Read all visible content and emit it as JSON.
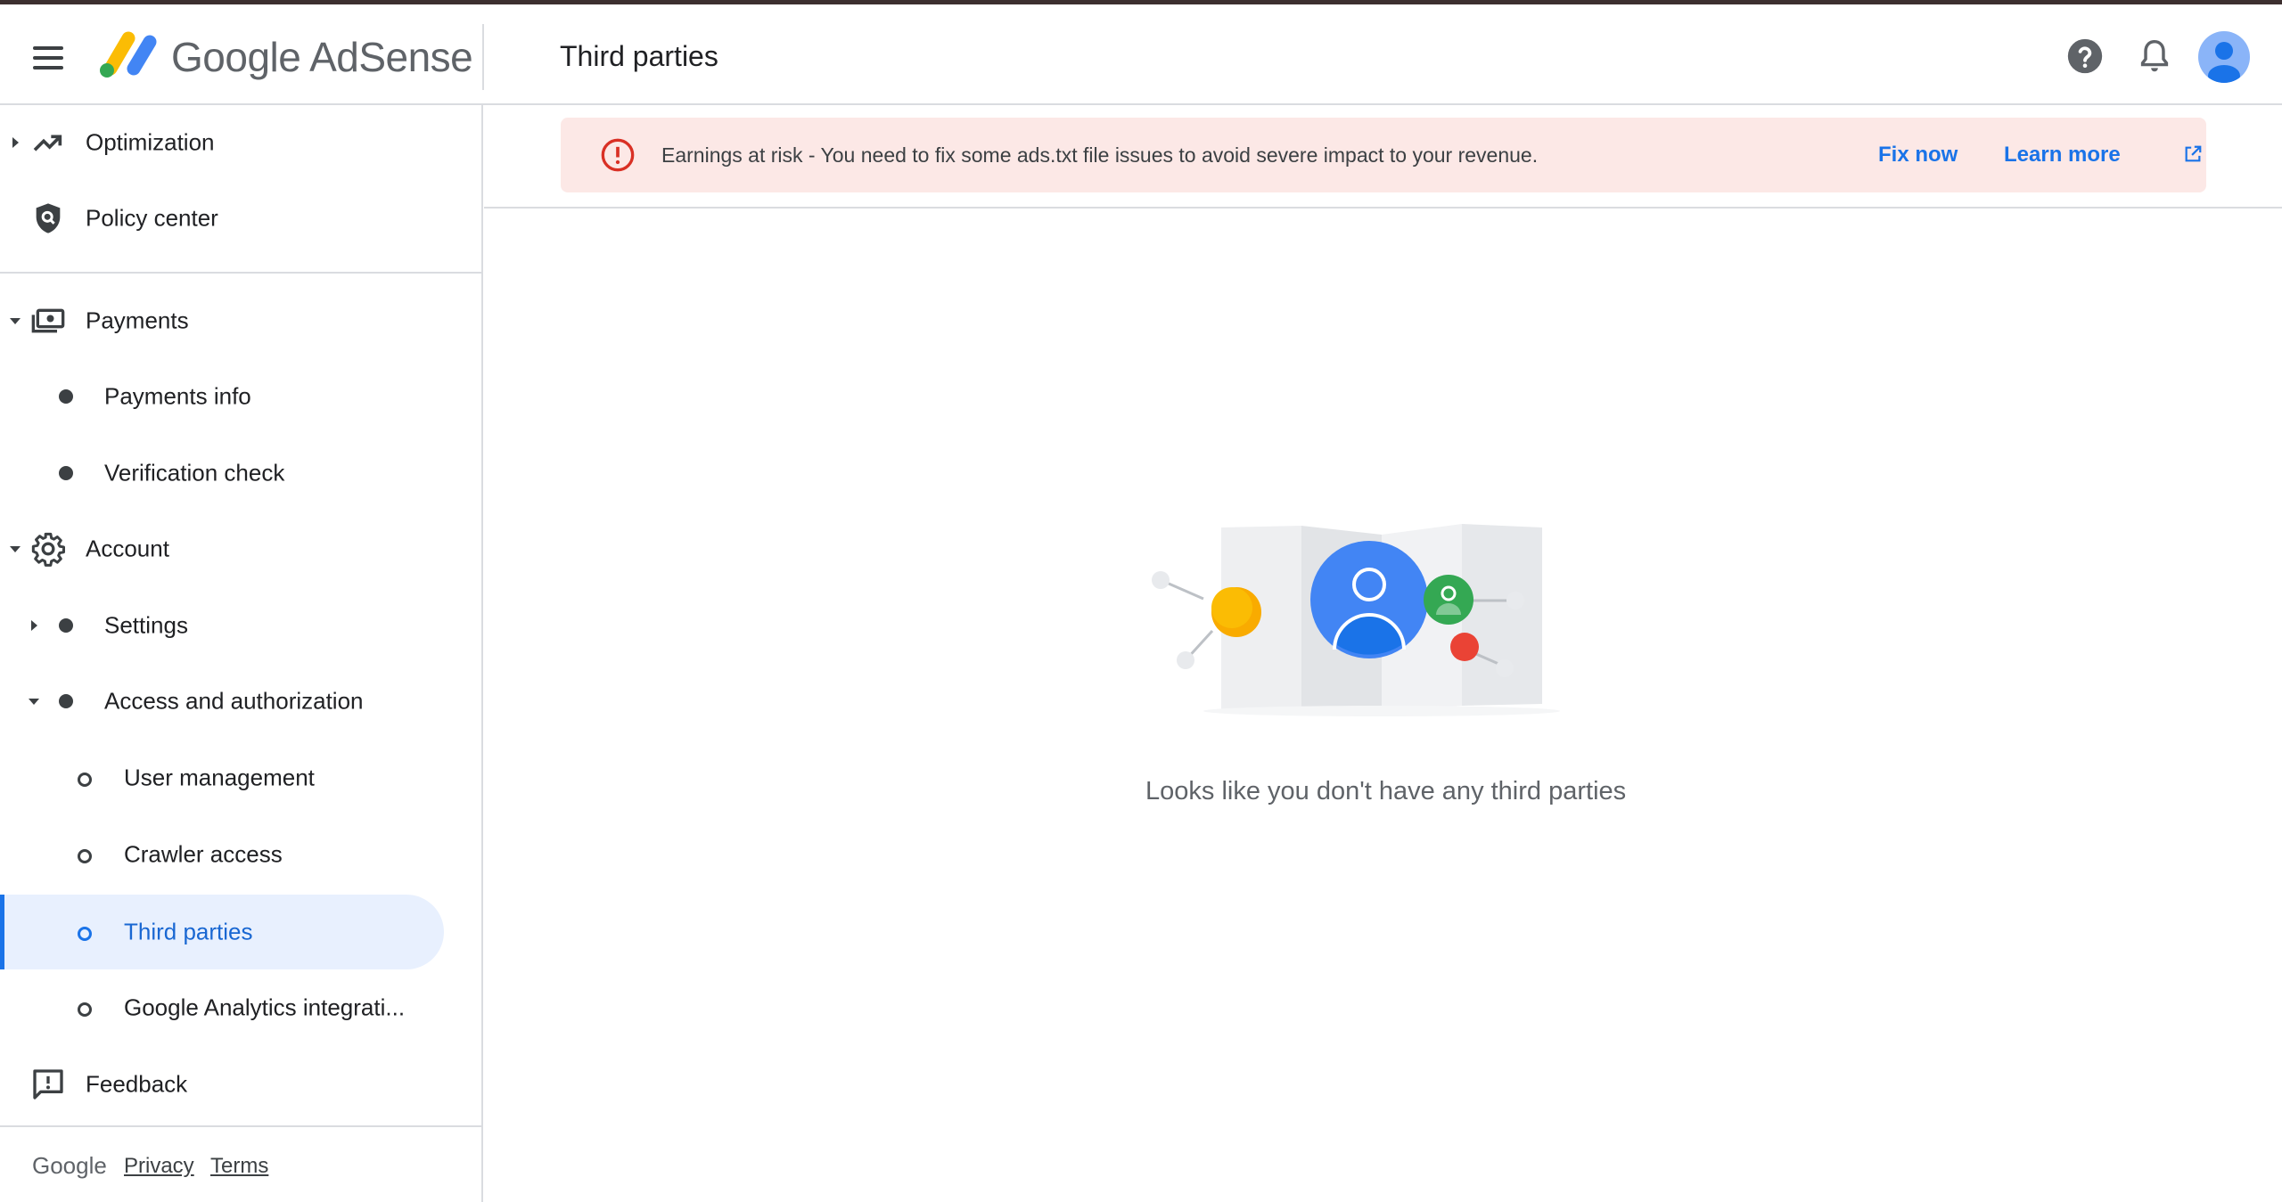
{
  "header": {
    "menu_icon": "menu-icon",
    "brand": "Google AdSense",
    "page_title": "Third parties",
    "help_icon": "help-icon",
    "notifications_icon": "bell-icon",
    "avatar_icon": "account-avatar-icon"
  },
  "sidebar": {
    "items": [
      {
        "label": "Optimization",
        "icon": "trending-up-icon",
        "caret": "right"
      },
      {
        "label": "Policy center",
        "icon": "shield-search-icon"
      },
      {
        "label": "Payments",
        "icon": "payments-icon",
        "caret": "down"
      },
      {
        "label": "Payments info",
        "bullet": "dot"
      },
      {
        "label": "Verification check",
        "bullet": "dot"
      },
      {
        "label": "Account",
        "icon": "gear-icon",
        "caret": "down"
      },
      {
        "label": "Settings",
        "bullet": "dot",
        "caret": "right"
      },
      {
        "label": "Access and authorization",
        "bullet": "dot",
        "caret": "down"
      },
      {
        "label": "User management",
        "bullet": "ring"
      },
      {
        "label": "Crawler access",
        "bullet": "ring"
      },
      {
        "label": "Third parties",
        "bullet": "ring",
        "active": true
      },
      {
        "label": "Google Analytics integrati...",
        "bullet": "ring"
      },
      {
        "label": "Feedback",
        "icon": "feedback-icon"
      }
    ],
    "footer": {
      "brand": "Google",
      "privacy": "Privacy",
      "terms": "Terms"
    }
  },
  "banner": {
    "icon": "error-icon",
    "text": "Earnings at risk - You need to fix some ads.txt file issues to avoid severe impact to your revenue.",
    "fix_now": "Fix now",
    "learn_more": "Learn more",
    "learn_more_icon": "open-in-new-icon"
  },
  "empty_state": {
    "illustration": "third-parties-map-illustration",
    "message": "Looks like you don't have any third parties"
  },
  "colors": {
    "accent": "#1a73e8",
    "active_bg": "#e8f0fe",
    "banner_bg": "#fce8e6",
    "error": "#d93025"
  }
}
